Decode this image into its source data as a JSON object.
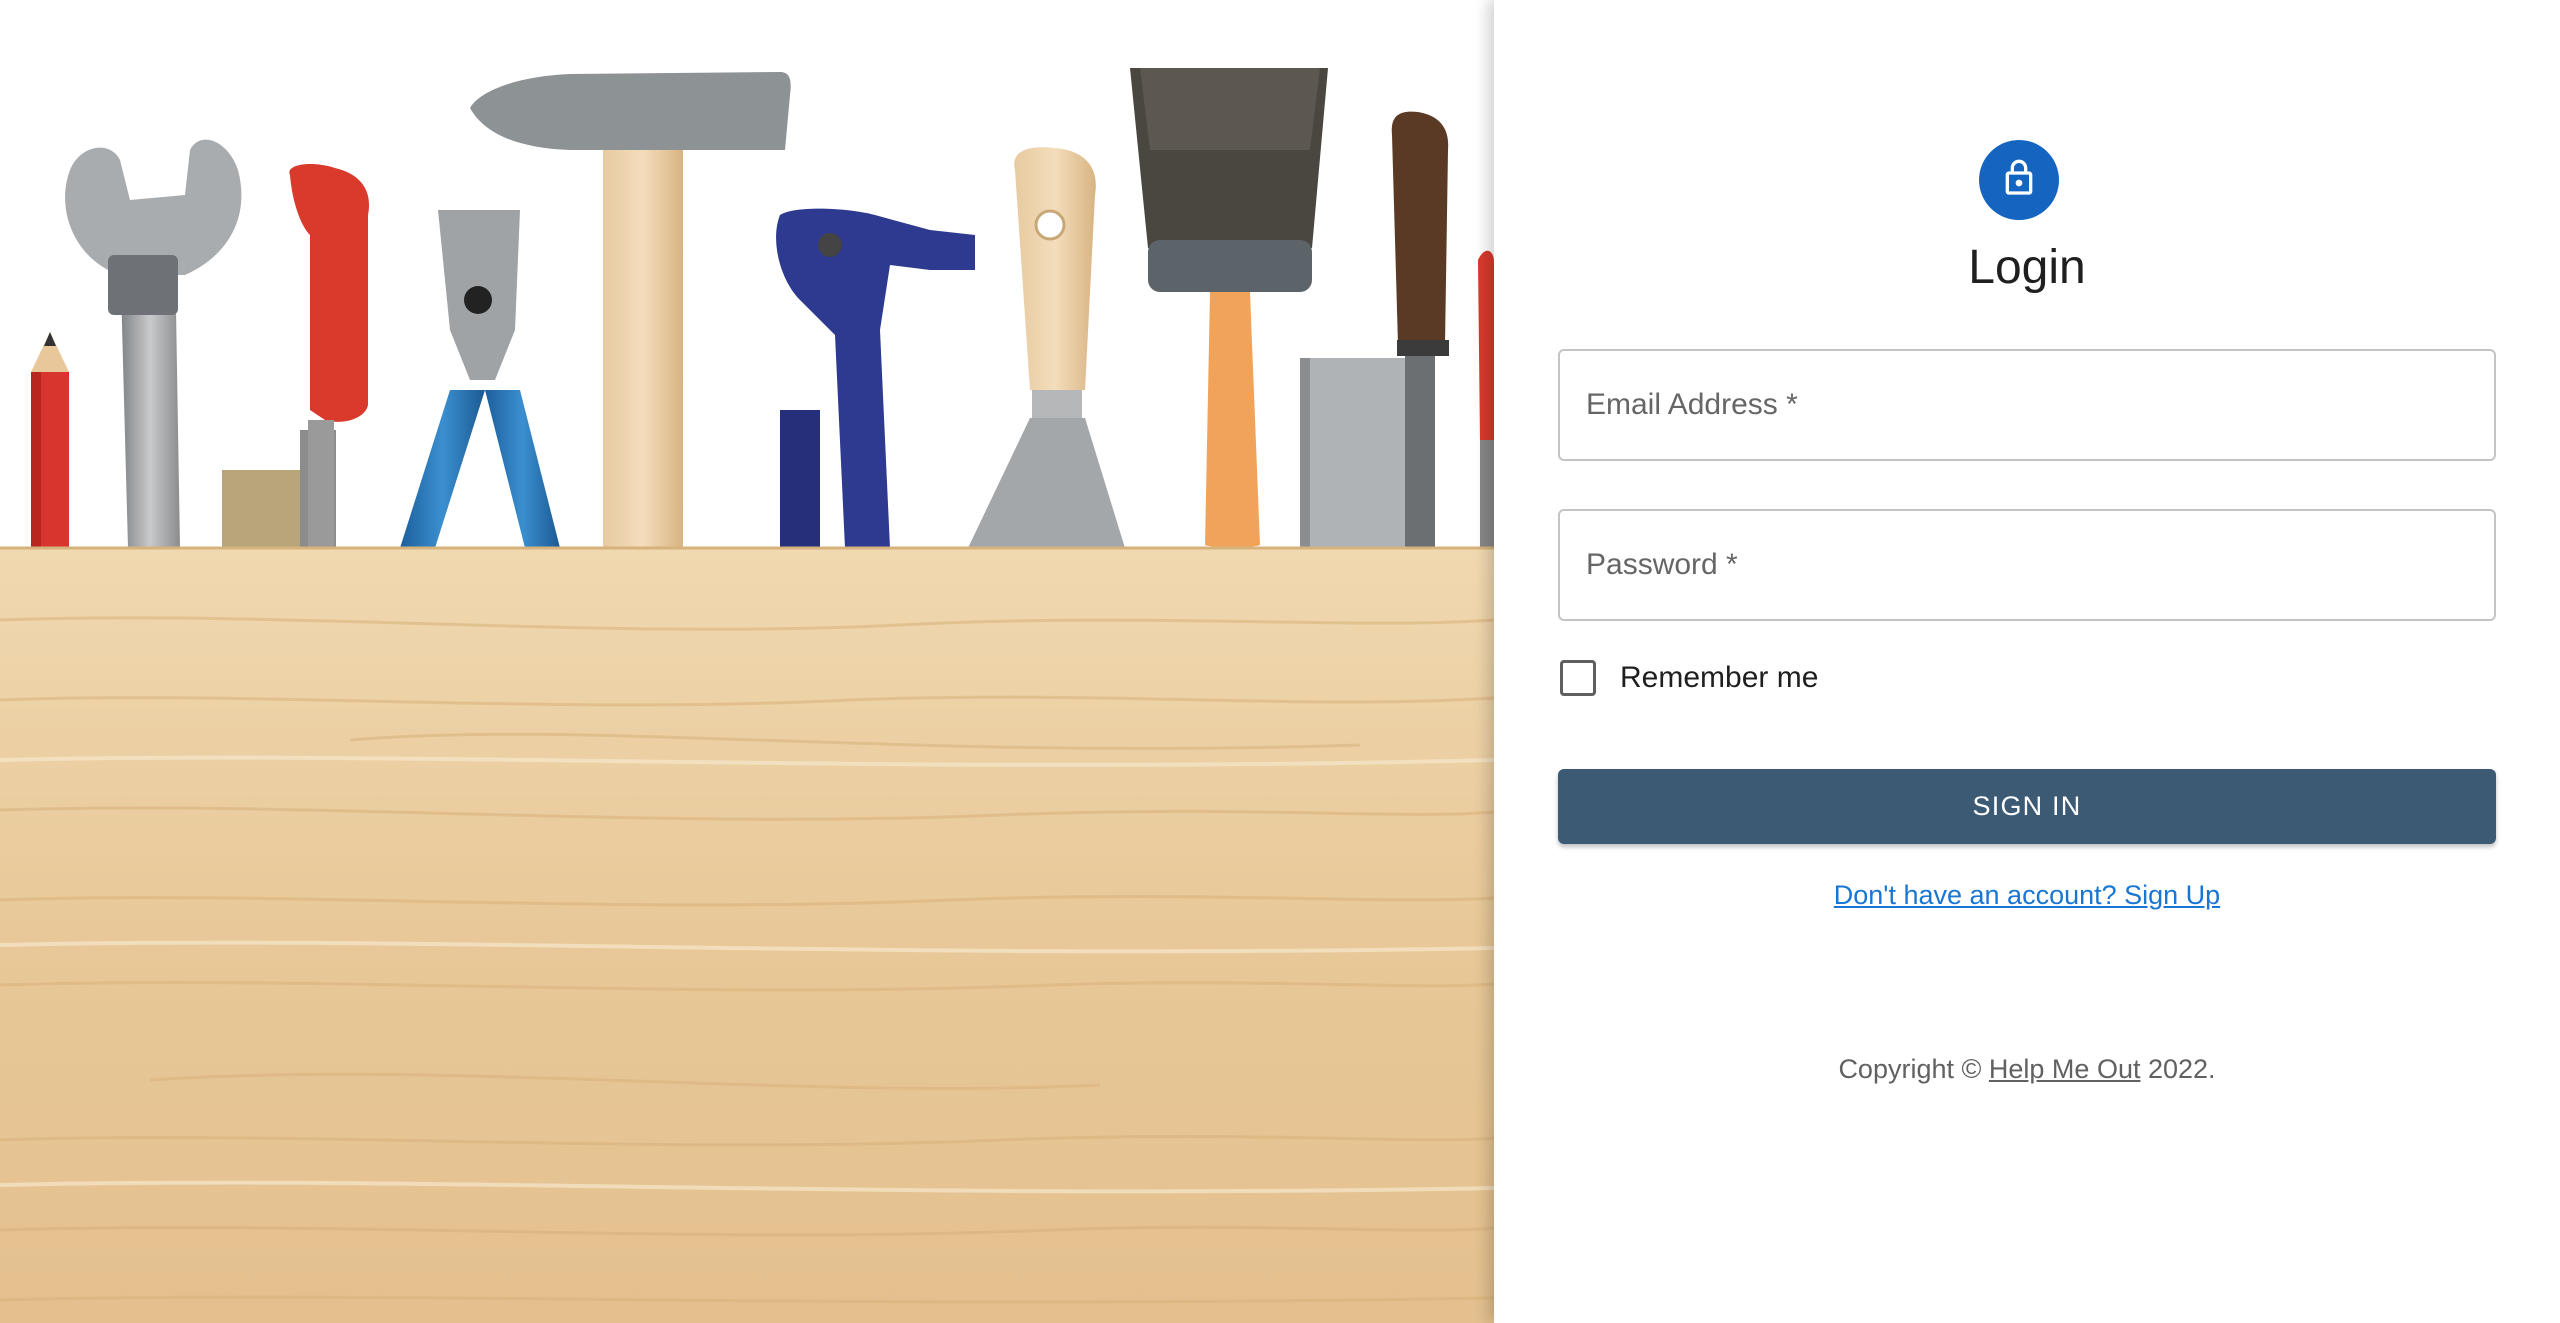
{
  "login": {
    "title": "Login",
    "icon": "lock-icon",
    "accent_color": "#1565c0",
    "email": {
      "label": "Email Address *",
      "value": ""
    },
    "password": {
      "label": "Password *",
      "value": ""
    },
    "remember": {
      "label": "Remember me",
      "checked": false
    },
    "signin_label": "SIGN IN",
    "signin_color": "#3d5a75",
    "signup_link": "Don't have an account? Sign Up"
  },
  "footer": {
    "prefix": "Copyright ©",
    "link": "Help Me Out",
    "suffix": "2022."
  },
  "hero": {
    "image": "hand-tools-on-wooden-board"
  }
}
